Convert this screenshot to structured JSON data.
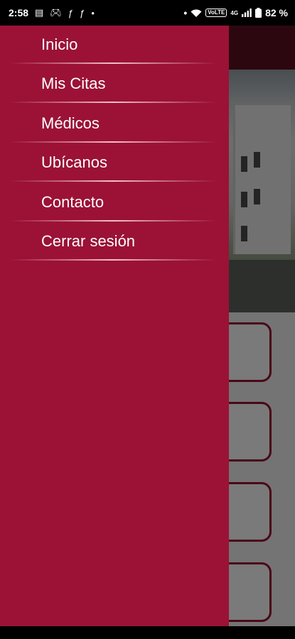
{
  "status_bar": {
    "time": "2:58",
    "left_icons": [
      "notes-icon",
      "game-controller-icon",
      "fx-icon",
      "fx-icon",
      "dot-icon"
    ],
    "network": "4G",
    "volte": "VoLTE",
    "battery": "82 %"
  },
  "drawer": {
    "items": [
      {
        "label": "Inicio"
      },
      {
        "label": "Mis Citas"
      },
      {
        "label": "Médicos"
      },
      {
        "label": "Ubícanos"
      },
      {
        "label": "Contacto"
      },
      {
        "label": "Cerrar sesión"
      }
    ]
  },
  "colors": {
    "drawer_background": "#9b1236",
    "header_dark": "#5c0f22",
    "card_border": "#9b1231"
  }
}
